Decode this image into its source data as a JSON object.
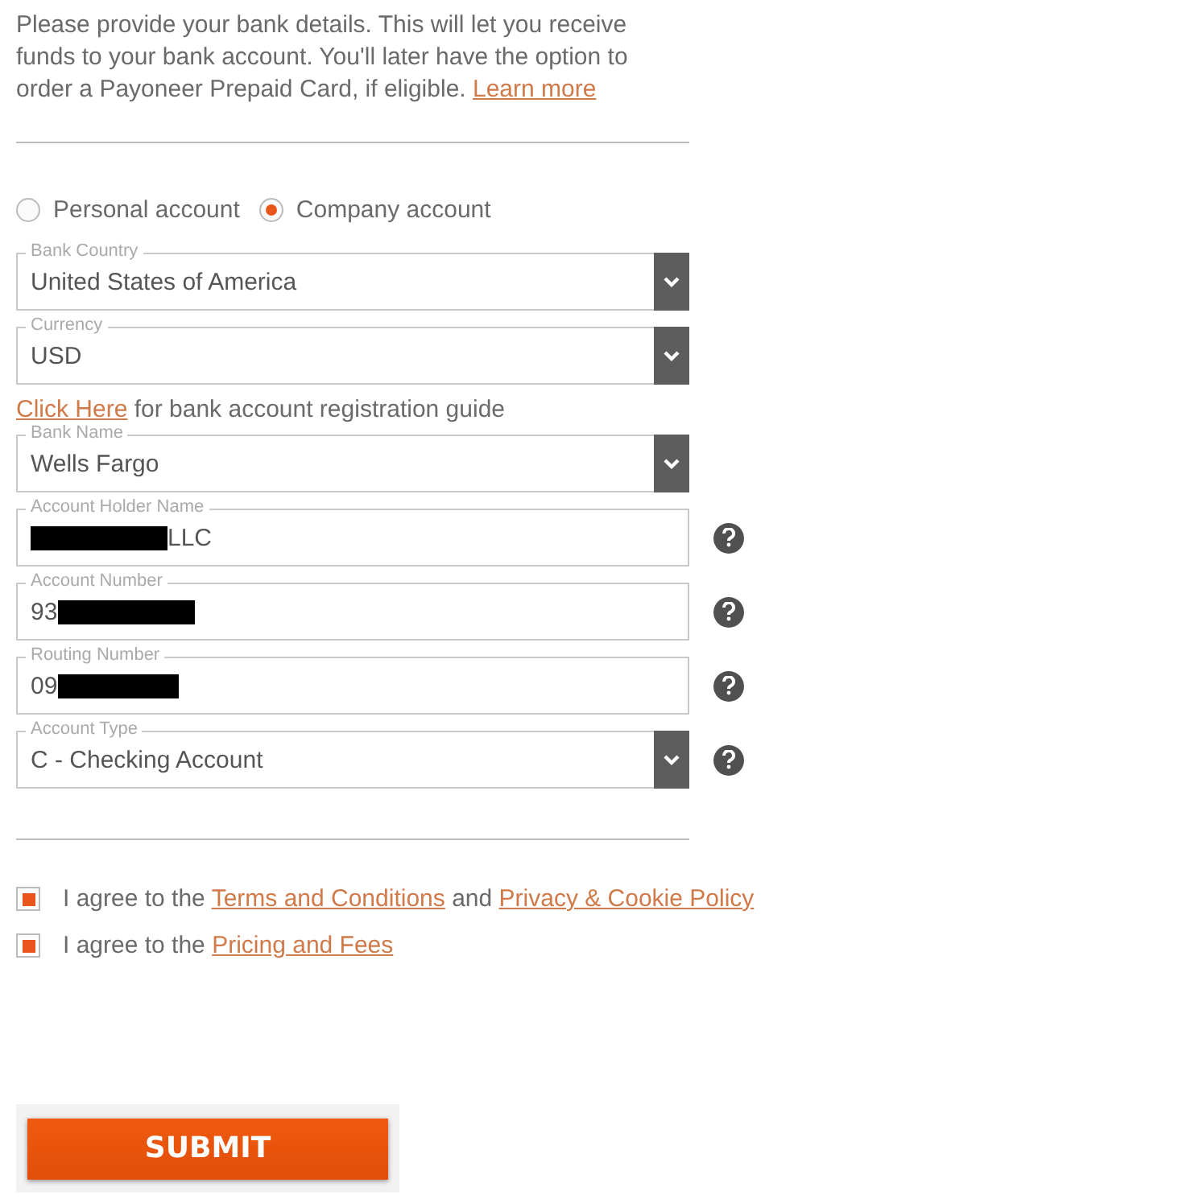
{
  "intro": {
    "text": "Please provide your bank details. This will let you receive funds to your bank account. You'll later have the option to order a Payoneer Prepaid Card, if eligible.",
    "link": "Learn more"
  },
  "account_types": [
    {
      "label": "Personal account",
      "selected": false
    },
    {
      "label": "Company account",
      "selected": true
    }
  ],
  "form_rows": [
    {
      "kind": "select",
      "label": "Bank Country",
      "value": "United States of America",
      "help": false
    },
    {
      "kind": "select",
      "label": "Currency",
      "value": "USD",
      "help": false
    },
    {
      "kind": "guide",
      "link": "Click Here",
      "text": "for bank account registration guide"
    },
    {
      "kind": "select",
      "label": "Bank Name",
      "value": "Wells Fargo",
      "help": false
    },
    {
      "kind": "input",
      "label": "Account Holder Name",
      "value": "LLC",
      "help": true,
      "redacted_before": true,
      "redacted_after": false
    },
    {
      "kind": "input",
      "label": "Account Number",
      "value": "93",
      "help": true,
      "redacted_before": false,
      "redacted_after": true
    },
    {
      "kind": "input",
      "label": "Routing Number",
      "value": "09",
      "help": true,
      "redacted_before": false,
      "redacted_after": true
    },
    {
      "kind": "select",
      "label": "Account Type",
      "value": "C - Checking Account",
      "help": true
    }
  ],
  "agreements": [
    {
      "checked": true,
      "parts": [
        {
          "kind": "text",
          "text": "I agree to the"
        },
        {
          "kind": "link",
          "text": "Terms and Conditions"
        },
        {
          "kind": "text",
          "text": "and"
        },
        {
          "kind": "link",
          "text": "Privacy & Cookie Policy"
        }
      ]
    },
    {
      "checked": true,
      "parts": [
        {
          "kind": "text",
          "text": "I agree to the"
        },
        {
          "kind": "link",
          "text": "Pricing and Fees"
        }
      ]
    }
  ],
  "submit": "SUBMIT"
}
